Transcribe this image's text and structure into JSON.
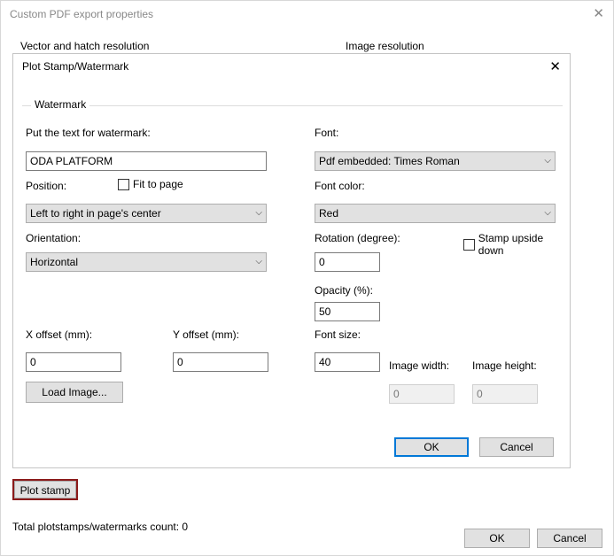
{
  "parent": {
    "title": "Custom PDF export properties",
    "vector_group": "Vector and hatch resolution",
    "image_group": "Image resolution",
    "plot_stamp_button": "Plot stamp",
    "total_count_label": "Total plotstamps/watermarks count: 0",
    "ok": "OK",
    "cancel": "Cancel"
  },
  "dialog": {
    "title": "Plot Stamp/Watermark",
    "fieldset": "Watermark",
    "text_label": "Put the text for watermark:",
    "text_value": "ODA PLATFORM",
    "position_label": "Position:",
    "position_value": "Left to right in page's center",
    "fit_to_page": "Fit to page",
    "orientation_label": "Orientation:",
    "orientation_value": "Horizontal",
    "font_label": "Font:",
    "font_value": "Pdf embedded: Times Roman",
    "font_color_label": "Font color:",
    "font_color_value": "Red",
    "rotation_label": "Rotation (degree):",
    "rotation_value": "0",
    "stamp_upside": "Stamp upside down",
    "opacity_label": "Opacity (%):",
    "opacity_value": "50",
    "font_size_label": "Font size:",
    "font_size_value": "40",
    "x_offset_label": "X offset (mm):",
    "x_offset_value": "0",
    "y_offset_label": "Y offset (mm):",
    "y_offset_value": "0",
    "load_image": "Load Image...",
    "image_width_label": "Image width:",
    "image_width_value": "0",
    "image_height_label": "Image height:",
    "image_height_value": "0",
    "ok": "OK",
    "cancel": "Cancel"
  }
}
